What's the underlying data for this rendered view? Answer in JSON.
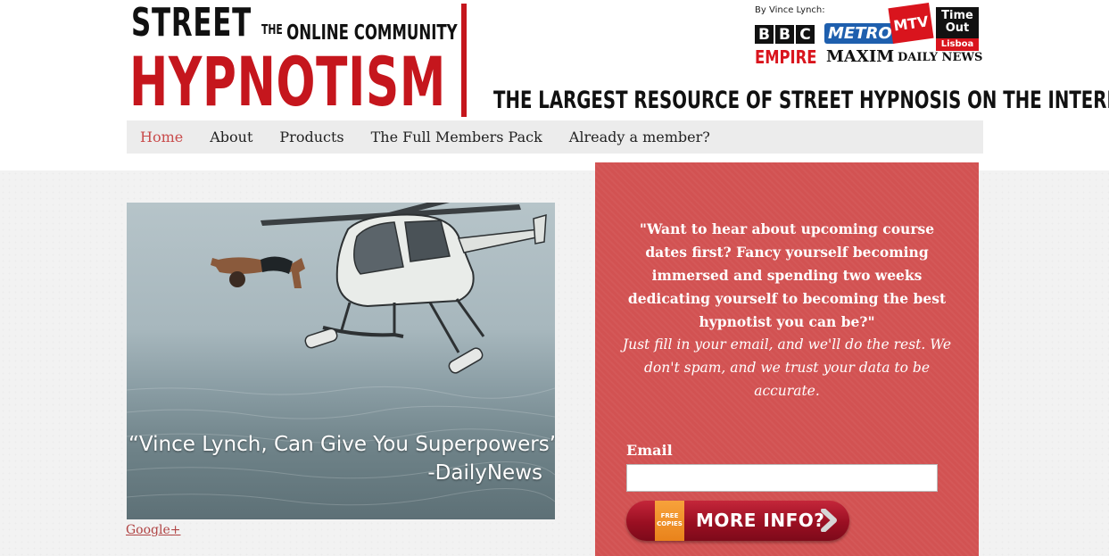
{
  "header": {
    "logo_street": "STREET",
    "logo_the": "THE",
    "logo_online": "ONLINE COMMUNITY",
    "logo_hypnotism": "HYPNOTISM",
    "tagline": "THE LARGEST RESOURCE OF STREET HYPNOSIS ON THE INTERNET",
    "press": {
      "by": "By Vince Lynch:",
      "bbc": [
        "B",
        "B",
        "C"
      ],
      "metro": "METRO",
      "mtv": "MTV",
      "timeout": "Time Out",
      "timeout_city": "Lisboa",
      "empire": "EMPIRE",
      "maxim": "MAXIM",
      "daily_news": "DAILY NEWS"
    },
    "colors": {
      "brand_red": "#c5161d",
      "panel_red": "#d25252",
      "nav_active": "#c94b4b"
    }
  },
  "nav": {
    "items": [
      {
        "label": "Home",
        "active": true
      },
      {
        "label": "About"
      },
      {
        "label": "Products"
      },
      {
        "label": "The Full Members Pack"
      },
      {
        "label": "Already a member?"
      }
    ]
  },
  "hero": {
    "quote": "“Vince Lynch, Can Give You Superpowers”",
    "source": "-DailyNews"
  },
  "google_plus_link": "Google+",
  "signup": {
    "quote": "\"Want to hear about upcoming course dates first? Fancy yourself becoming immersed and spending two weeks dedicating yourself to becoming the best hypnotist you can be?\"",
    "note": "Just fill in your email, and we'll do the rest. We don't spam, and we trust your data to be accurate.",
    "email_label": "Email",
    "email_value": "",
    "button_tag": "FREE COPIES",
    "button_label": "MORE INFO?",
    "arrow_icon": "chevron-right-icon"
  }
}
